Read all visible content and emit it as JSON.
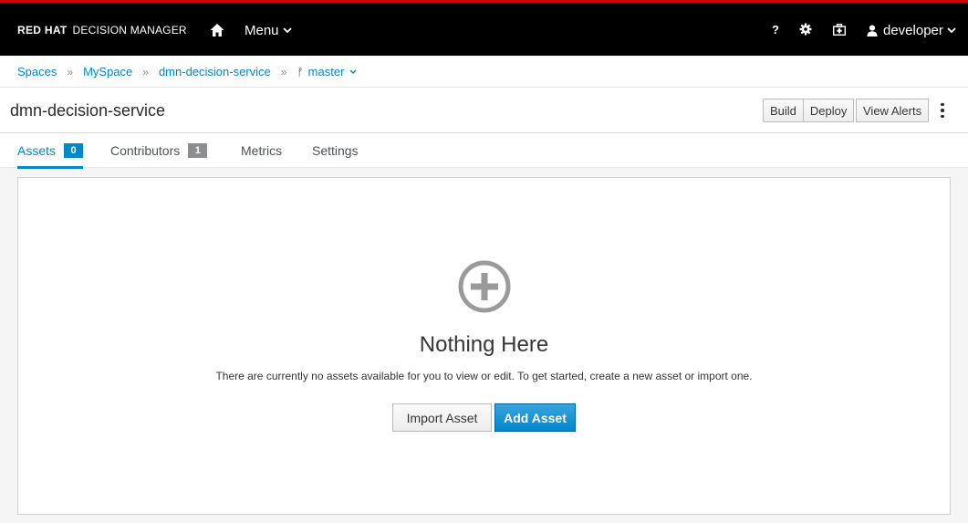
{
  "masthead": {
    "brand_bold": "RED HAT",
    "brand_light": "DECISION MANAGER",
    "menu_label": "Menu",
    "help_label": "?",
    "user_label": "developer",
    "accent_color": "#cc0000"
  },
  "icons": {
    "home": "home-icon",
    "menu_chevron": "chevron-down-icon",
    "help": "question-icon",
    "settings": "gear-icon",
    "admin": "briefcase-icon",
    "user": "user-icon",
    "branch": "code-branch-icon",
    "kebab": "kebab-menu-icon",
    "empty_state": "plus-circle-icon"
  },
  "breadcrumb": {
    "items": [
      "Spaces",
      "MySpace",
      "dmn-decision-service"
    ],
    "separator": "»",
    "branch_label": "master",
    "branch_glyph": "ᚠ"
  },
  "project": {
    "title": "dmn-decision-service",
    "build_label": "Build",
    "deploy_label": "Deploy",
    "alerts_label": "View Alerts"
  },
  "tabs": [
    {
      "label": "Assets",
      "badge": "0",
      "active": true
    },
    {
      "label": "Contributors",
      "badge": "1",
      "active": false
    },
    {
      "label": "Metrics",
      "badge": null,
      "active": false
    },
    {
      "label": "Settings",
      "badge": null,
      "active": false
    }
  ],
  "empty_state": {
    "title": "Nothing Here",
    "message": "There are currently no assets available for you to view or edit. To get started, create a new asset or import one.",
    "import_label": "Import Asset",
    "add_label": "Add Asset"
  },
  "colors": {
    "link": "#0088ce",
    "primary_button": "#0088ce",
    "badge_inactive": "#8b8d8f",
    "empty_icon": "#9a9a9a"
  }
}
